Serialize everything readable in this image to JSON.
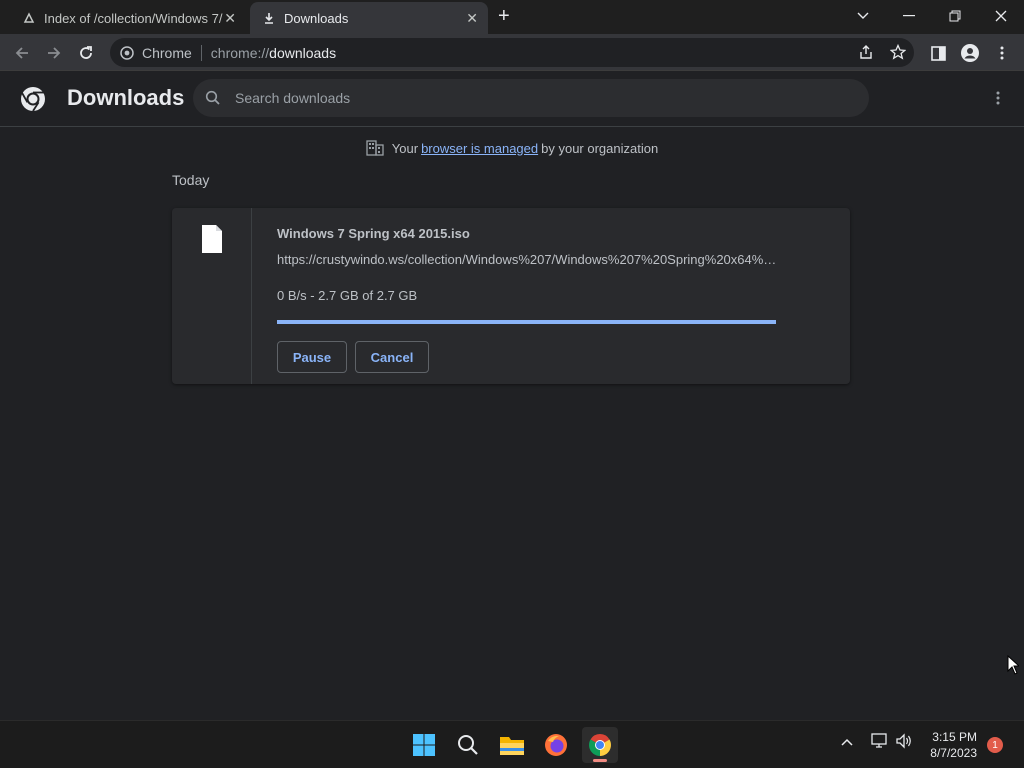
{
  "tabs": [
    {
      "title": "Index of /collection/Windows 7/",
      "icon": "site-icon"
    },
    {
      "title": "Downloads",
      "icon": "download-icon"
    }
  ],
  "omnibox": {
    "chip_label": "Chrome",
    "url_scheme": "chrome://",
    "url_host": "downloads"
  },
  "header": {
    "title": "Downloads",
    "search_placeholder": "Search downloads"
  },
  "managed": {
    "prefix": "Your",
    "link": "browser is managed",
    "suffix": "by your organization"
  },
  "section_label": "Today",
  "download": {
    "filename": "Windows 7 Spring x64 2015.iso",
    "url": "https://crustywindo.ws/collection/Windows%207/Windows%207%20Spring%20x64%…",
    "status": "0 B/s - 2.7 GB of 2.7 GB",
    "progress_percent": 100,
    "pause_label": "Pause",
    "cancel_label": "Cancel"
  },
  "taskbar": {
    "time": "3:15 PM",
    "date": "8/7/2023",
    "notifications": "1"
  },
  "colors": {
    "accent": "#8ab4f8",
    "background": "#202124",
    "card": "#292a2d"
  }
}
